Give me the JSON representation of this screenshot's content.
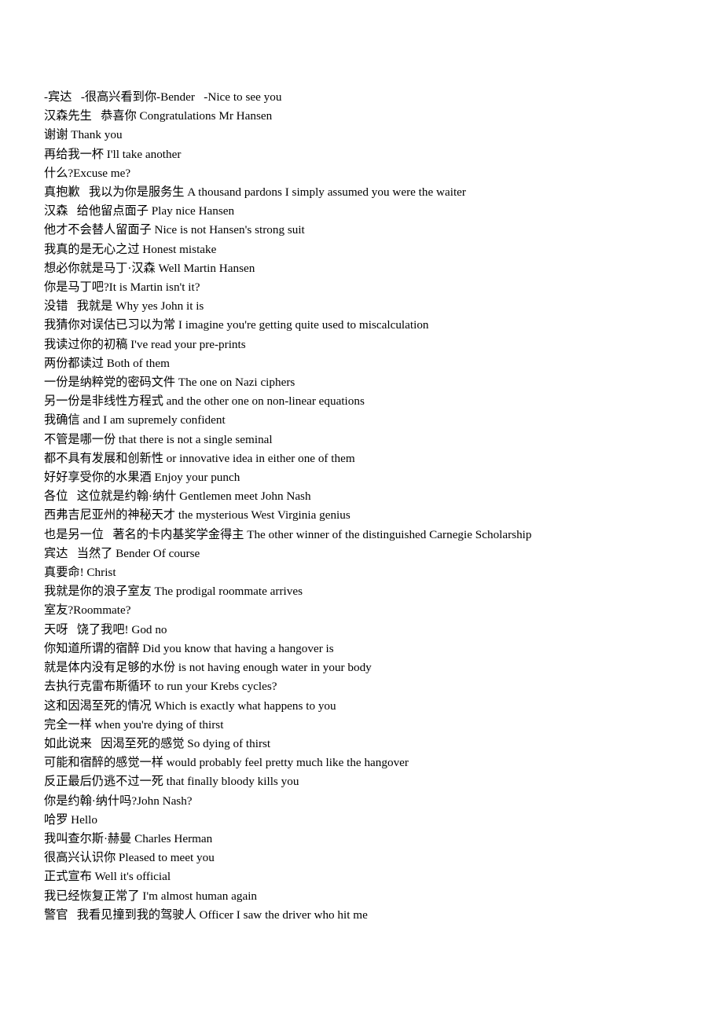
{
  "document": {
    "background_color": "#ffffff",
    "text_color": "#000000",
    "lines": [
      {
        "text": "-宾达   -很高兴看到你-Bender   -Nice to see you"
      },
      {
        "text": "汉森先生   恭喜你 Congratulations Mr Hansen"
      },
      {
        "text": "谢谢 Thank you"
      },
      {
        "text": "再给我一杯 I'll take another"
      },
      {
        "text": "什么?Excuse me?"
      },
      {
        "text": "真抱歉   我以为你是服务生 A thousand pardons I simply assumed you were the waiter"
      },
      {
        "text": "汉森   给他留点面子 Play nice Hansen"
      },
      {
        "text": "他才不会替人留面子 Nice is not Hansen's strong suit"
      },
      {
        "text": "我真的是无心之过 Honest mistake"
      },
      {
        "text": "想必你就是马丁·汉森 Well Martin Hansen"
      },
      {
        "text": "你是马丁吧?It is Martin isn't it?"
      },
      {
        "text": "没错   我就是 Why yes John it is"
      },
      {
        "text": "我猜你对误估已习以为常 I imagine you're getting quite used to miscalculation"
      },
      {
        "text": "我读过你的初稿 I've read your pre-prints"
      },
      {
        "text": "两份都读过 Both of them"
      },
      {
        "text": "一份是纳粹党的密码文件 The one on Nazi ciphers"
      },
      {
        "text": "另一份是非线性方程式 and the other one on non-linear equations"
      },
      {
        "text": "我确信 and I am supremely confident"
      },
      {
        "text": "不管是哪一份 that there is not a single seminal"
      },
      {
        "text": "都不具有发展和创新性 or innovative idea in either one of them"
      },
      {
        "text": "好好享受你的水果酒 Enjoy your punch"
      },
      {
        "text": "各位   这位就是约翰·纳什 Gentlemen meet John Nash"
      },
      {
        "text": "西弗吉尼亚州的神秘天才 the mysterious West Virginia genius"
      },
      {
        "text": "也是另一位   著名的卡内基奖学金得主 The other winner of the distinguished Carnegie Scholarship"
      },
      {
        "text": "宾达   当然了 Bender Of course"
      },
      {
        "text": "真要命! Christ"
      },
      {
        "text": "我就是你的浪子室友 The prodigal roommate arrives"
      },
      {
        "text": "室友?Roommate?"
      },
      {
        "text": "天呀   饶了我吧! God no"
      },
      {
        "text": "你知道所谓的宿醉 Did you know that having a hangover is"
      },
      {
        "text": "就是体内没有足够的水份 is not having enough water in your body"
      },
      {
        "text": "去执行克雷布斯循环 to run your Krebs cycles?"
      },
      {
        "text": "这和因渴至死的情况 Which is exactly what happens to you"
      },
      {
        "text": "完全一样 when you're dying of thirst"
      },
      {
        "text": "如此说来   因渴至死的感觉 So dying of thirst"
      },
      {
        "text": "可能和宿醉的感觉一样 would probably feel pretty much like the hangover"
      },
      {
        "text": "反正最后仍逃不过一死 that finally bloody kills you"
      },
      {
        "text": "你是约翰·纳什吗?John Nash?"
      },
      {
        "text": "哈罗 Hello"
      },
      {
        "text": "我叫查尔斯·赫曼 Charles Herman"
      },
      {
        "text": "很高兴认识你 Pleased to meet you"
      },
      {
        "text": "正式宣布 Well it's official"
      },
      {
        "text": "我已经恢复正常了 I'm almost human again"
      },
      {
        "text": "警官   我看见撞到我的驾驶人 Officer I saw the driver who hit me"
      }
    ]
  }
}
